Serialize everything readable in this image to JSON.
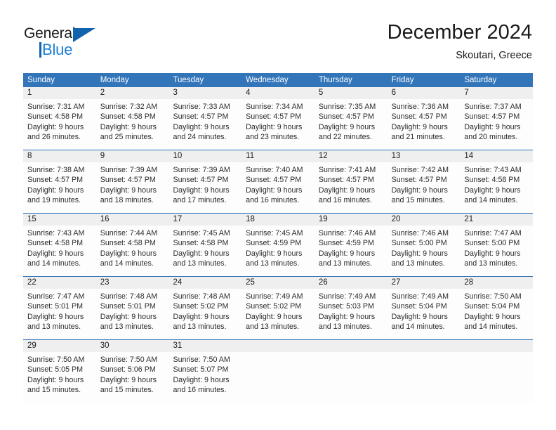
{
  "brand": {
    "name_part1": "General",
    "name_part2": "Blue",
    "logo_icon": "triangle-icon"
  },
  "header": {
    "month_title": "December 2024",
    "location": "Skoutari, Greece"
  },
  "colors": {
    "header_blue": "#3275b9",
    "row_divider_blue": "#3275b9",
    "daynum_band": "#efefef",
    "logo_blue": "#1263ad",
    "logo_text_blue": "#1a7fd4",
    "text": "#1a1a1a"
  },
  "calendar": {
    "weekday_headers": [
      "Sunday",
      "Monday",
      "Tuesday",
      "Wednesday",
      "Thursday",
      "Friday",
      "Saturday"
    ],
    "weeks": [
      {
        "days": [
          {
            "num": "1",
            "l1": "Sunrise: 7:31 AM",
            "l2": "Sunset: 4:58 PM",
            "l3": "Daylight: 9 hours",
            "l4": "and 26 minutes."
          },
          {
            "num": "2",
            "l1": "Sunrise: 7:32 AM",
            "l2": "Sunset: 4:58 PM",
            "l3": "Daylight: 9 hours",
            "l4": "and 25 minutes."
          },
          {
            "num": "3",
            "l1": "Sunrise: 7:33 AM",
            "l2": "Sunset: 4:57 PM",
            "l3": "Daylight: 9 hours",
            "l4": "and 24 minutes."
          },
          {
            "num": "4",
            "l1": "Sunrise: 7:34 AM",
            "l2": "Sunset: 4:57 PM",
            "l3": "Daylight: 9 hours",
            "l4": "and 23 minutes."
          },
          {
            "num": "5",
            "l1": "Sunrise: 7:35 AM",
            "l2": "Sunset: 4:57 PM",
            "l3": "Daylight: 9 hours",
            "l4": "and 22 minutes."
          },
          {
            "num": "6",
            "l1": "Sunrise: 7:36 AM",
            "l2": "Sunset: 4:57 PM",
            "l3": "Daylight: 9 hours",
            "l4": "and 21 minutes."
          },
          {
            "num": "7",
            "l1": "Sunrise: 7:37 AM",
            "l2": "Sunset: 4:57 PM",
            "l3": "Daylight: 9 hours",
            "l4": "and 20 minutes."
          }
        ]
      },
      {
        "days": [
          {
            "num": "8",
            "l1": "Sunrise: 7:38 AM",
            "l2": "Sunset: 4:57 PM",
            "l3": "Daylight: 9 hours",
            "l4": "and 19 minutes."
          },
          {
            "num": "9",
            "l1": "Sunrise: 7:39 AM",
            "l2": "Sunset: 4:57 PM",
            "l3": "Daylight: 9 hours",
            "l4": "and 18 minutes."
          },
          {
            "num": "10",
            "l1": "Sunrise: 7:39 AM",
            "l2": "Sunset: 4:57 PM",
            "l3": "Daylight: 9 hours",
            "l4": "and 17 minutes."
          },
          {
            "num": "11",
            "l1": "Sunrise: 7:40 AM",
            "l2": "Sunset: 4:57 PM",
            "l3": "Daylight: 9 hours",
            "l4": "and 16 minutes."
          },
          {
            "num": "12",
            "l1": "Sunrise: 7:41 AM",
            "l2": "Sunset: 4:57 PM",
            "l3": "Daylight: 9 hours",
            "l4": "and 16 minutes."
          },
          {
            "num": "13",
            "l1": "Sunrise: 7:42 AM",
            "l2": "Sunset: 4:57 PM",
            "l3": "Daylight: 9 hours",
            "l4": "and 15 minutes."
          },
          {
            "num": "14",
            "l1": "Sunrise: 7:43 AM",
            "l2": "Sunset: 4:58 PM",
            "l3": "Daylight: 9 hours",
            "l4": "and 14 minutes."
          }
        ]
      },
      {
        "days": [
          {
            "num": "15",
            "l1": "Sunrise: 7:43 AM",
            "l2": "Sunset: 4:58 PM",
            "l3": "Daylight: 9 hours",
            "l4": "and 14 minutes."
          },
          {
            "num": "16",
            "l1": "Sunrise: 7:44 AM",
            "l2": "Sunset: 4:58 PM",
            "l3": "Daylight: 9 hours",
            "l4": "and 14 minutes."
          },
          {
            "num": "17",
            "l1": "Sunrise: 7:45 AM",
            "l2": "Sunset: 4:58 PM",
            "l3": "Daylight: 9 hours",
            "l4": "and 13 minutes."
          },
          {
            "num": "18",
            "l1": "Sunrise: 7:45 AM",
            "l2": "Sunset: 4:59 PM",
            "l3": "Daylight: 9 hours",
            "l4": "and 13 minutes."
          },
          {
            "num": "19",
            "l1": "Sunrise: 7:46 AM",
            "l2": "Sunset: 4:59 PM",
            "l3": "Daylight: 9 hours",
            "l4": "and 13 minutes."
          },
          {
            "num": "20",
            "l1": "Sunrise: 7:46 AM",
            "l2": "Sunset: 5:00 PM",
            "l3": "Daylight: 9 hours",
            "l4": "and 13 minutes."
          },
          {
            "num": "21",
            "l1": "Sunrise: 7:47 AM",
            "l2": "Sunset: 5:00 PM",
            "l3": "Daylight: 9 hours",
            "l4": "and 13 minutes."
          }
        ]
      },
      {
        "days": [
          {
            "num": "22",
            "l1": "Sunrise: 7:47 AM",
            "l2": "Sunset: 5:01 PM",
            "l3": "Daylight: 9 hours",
            "l4": "and 13 minutes."
          },
          {
            "num": "23",
            "l1": "Sunrise: 7:48 AM",
            "l2": "Sunset: 5:01 PM",
            "l3": "Daylight: 9 hours",
            "l4": "and 13 minutes."
          },
          {
            "num": "24",
            "l1": "Sunrise: 7:48 AM",
            "l2": "Sunset: 5:02 PM",
            "l3": "Daylight: 9 hours",
            "l4": "and 13 minutes."
          },
          {
            "num": "25",
            "l1": "Sunrise: 7:49 AM",
            "l2": "Sunset: 5:02 PM",
            "l3": "Daylight: 9 hours",
            "l4": "and 13 minutes."
          },
          {
            "num": "26",
            "l1": "Sunrise: 7:49 AM",
            "l2": "Sunset: 5:03 PM",
            "l3": "Daylight: 9 hours",
            "l4": "and 13 minutes."
          },
          {
            "num": "27",
            "l1": "Sunrise: 7:49 AM",
            "l2": "Sunset: 5:04 PM",
            "l3": "Daylight: 9 hours",
            "l4": "and 14 minutes."
          },
          {
            "num": "28",
            "l1": "Sunrise: 7:50 AM",
            "l2": "Sunset: 5:04 PM",
            "l3": "Daylight: 9 hours",
            "l4": "and 14 minutes."
          }
        ]
      },
      {
        "days": [
          {
            "num": "29",
            "l1": "Sunrise: 7:50 AM",
            "l2": "Sunset: 5:05 PM",
            "l3": "Daylight: 9 hours",
            "l4": "and 15 minutes."
          },
          {
            "num": "30",
            "l1": "Sunrise: 7:50 AM",
            "l2": "Sunset: 5:06 PM",
            "l3": "Daylight: 9 hours",
            "l4": "and 15 minutes."
          },
          {
            "num": "31",
            "l1": "Sunrise: 7:50 AM",
            "l2": "Sunset: 5:07 PM",
            "l3": "Daylight: 9 hours",
            "l4": "and 16 minutes."
          },
          {
            "num": "",
            "l1": "",
            "l2": "",
            "l3": "",
            "l4": ""
          },
          {
            "num": "",
            "l1": "",
            "l2": "",
            "l3": "",
            "l4": ""
          },
          {
            "num": "",
            "l1": "",
            "l2": "",
            "l3": "",
            "l4": ""
          },
          {
            "num": "",
            "l1": "",
            "l2": "",
            "l3": "",
            "l4": ""
          }
        ]
      }
    ]
  }
}
